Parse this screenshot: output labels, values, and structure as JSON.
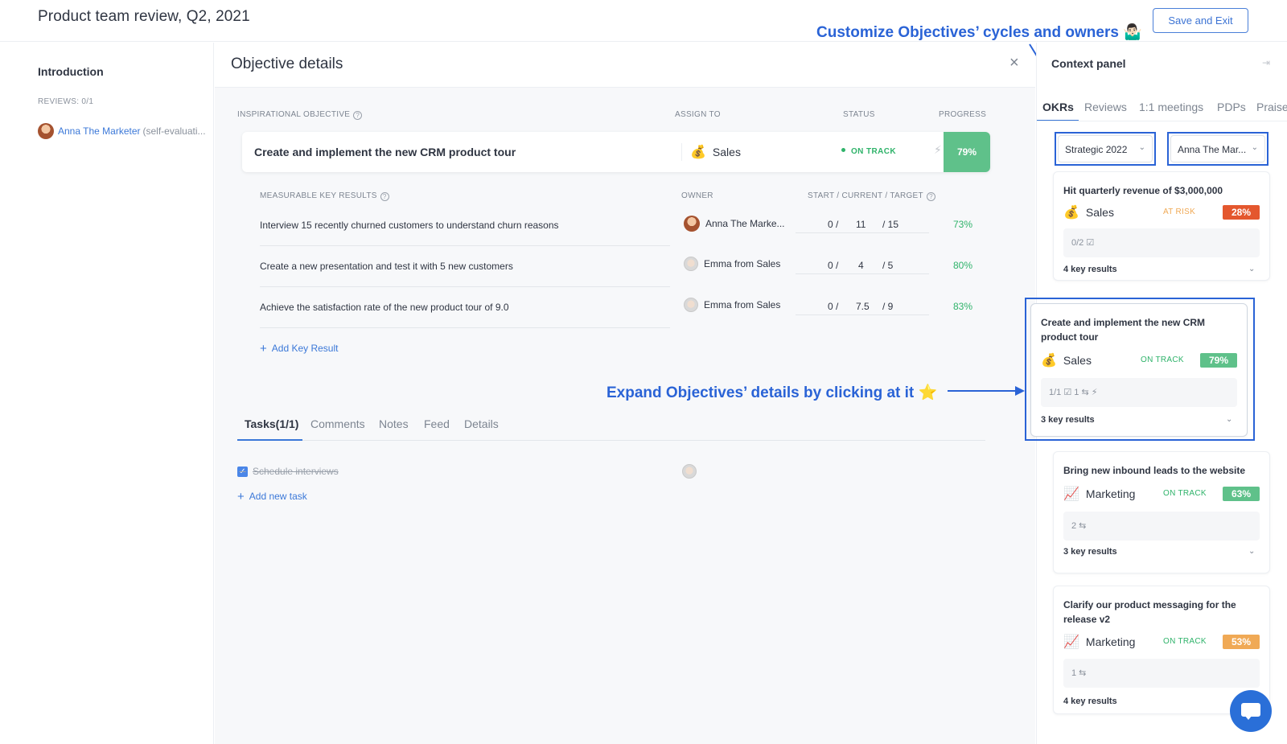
{
  "header": {
    "title": "Product team review, Q2, 2021",
    "save_label": "Save and Exit"
  },
  "sidebar": {
    "title": "Introduction",
    "reviews": "REVIEWS: 0/1",
    "person_name": "Anna The Marketer",
    "person_sub": "(self-evaluati..."
  },
  "details": {
    "title": "Objective details",
    "close_icon": "×",
    "headers": {
      "objective": "INSPIRATIONAL OBJECTIVE",
      "assign": "ASSIGN TO",
      "status": "STATUS",
      "progress": "PROGRESS"
    },
    "objective": {
      "title": "Create and implement the new CRM product tour",
      "team": "Sales",
      "team_icon": "money-bag-icon",
      "status": "ON TRACK",
      "progress": "79%"
    },
    "kr_headers": {
      "measurable": "MEASURABLE KEY RESULTS",
      "owner": "OWNER",
      "start": "START",
      "current": "CURRENT",
      "target": "TARGET"
    },
    "key_results": [
      {
        "text": "Interview 15 recently churned customers to understand churn reasons",
        "owner": "Anna The Marke...",
        "start": "0 /",
        "current": "11",
        "target": "/ 15",
        "pct": "73%"
      },
      {
        "text": "Create a new presentation and test it with 5 new customers",
        "owner": "Emma from Sales",
        "start": "0 /",
        "current": "4",
        "target": "/ 5",
        "pct": "80%"
      },
      {
        "text": "Achieve the satisfaction rate of the new product tour of 9.0",
        "owner": "Emma from Sales",
        "start": "0 /",
        "current": "7.5",
        "target": "/ 9",
        "pct": "83%"
      }
    ],
    "add_kr": "Add Key Result",
    "tabs": [
      "Tasks(1/1)",
      "Comments",
      "Notes",
      "Feed",
      "Details"
    ],
    "task": "Schedule interviews",
    "add_task": "Add new task"
  },
  "annotations": {
    "top": "Customize Objectives’ cycles and owners 🤷🏻‍♂️",
    "middle": "Expand Objectives’ details by clicking at it ⭐",
    "color": "#2a63d6"
  },
  "context": {
    "title": "Context panel",
    "collapse_icon": "⇥",
    "tabs": [
      "OKRs",
      "Reviews",
      "1:1 meetings",
      "PDPs",
      "Praise"
    ],
    "cycle_select": "Strategic 2022",
    "owner_select": "Anna The Mar...",
    "cards": [
      {
        "title": "Hit quarterly revenue of $3,000,000",
        "team": "Sales",
        "status": "AT RISK",
        "pct": "28%",
        "meta": "0/2 ☑",
        "foot": "4 key results",
        "color": "#e4572e"
      },
      {
        "title": "Create and implement the new CRM product tour",
        "team": "Sales",
        "status": "ON TRACK",
        "pct": "79%",
        "meta": "1/1 ☑     1 ⇆     ⚡",
        "foot": "3 key results",
        "color": "#5fc18a"
      },
      {
        "title": "Bring new inbound leads to the website",
        "team": "Marketing",
        "status": "ON TRACK",
        "pct": "63%",
        "meta": "2 ⇆",
        "foot": "3 key results",
        "color": "#5fc18a"
      },
      {
        "title": "Clarify our product messaging for the release v2",
        "team": "Marketing",
        "status": "ON TRACK",
        "pct": "53%",
        "meta": "1 ⇆",
        "foot": "4 key results",
        "color": "#f0a955"
      }
    ]
  },
  "colors": {
    "accent": "#3b78d8",
    "on_track": "#2fb36a",
    "at_risk": "#f0a955"
  }
}
